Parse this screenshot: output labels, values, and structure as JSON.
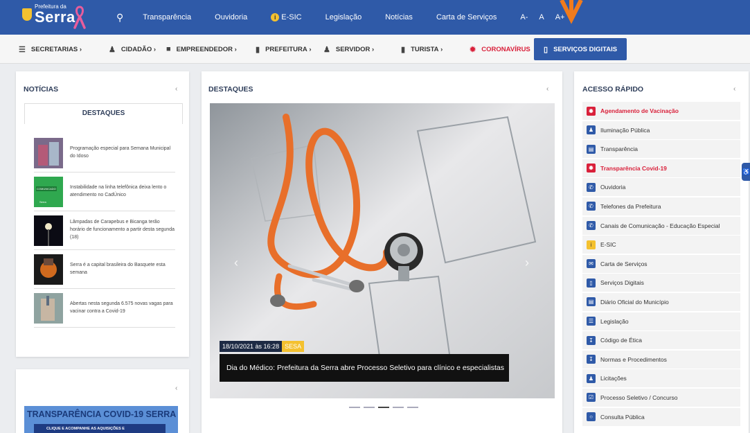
{
  "colors": {
    "primary": "#2f5aa8",
    "accent_red": "#d9203a",
    "accent_yellow": "#f4c12f"
  },
  "header": {
    "logo_small": "Prefeitura da",
    "logo_big": "Serra",
    "nav": [
      {
        "label": "Transparência",
        "icon": ""
      },
      {
        "label": "Ouvidoria",
        "icon": ""
      },
      {
        "label": "E-SIC",
        "icon": "info-icon"
      },
      {
        "label": "Legislação",
        "icon": ""
      },
      {
        "label": "Notícias",
        "icon": ""
      },
      {
        "label": "Carta de Serviços",
        "icon": ""
      }
    ],
    "font_controls": [
      "A-",
      "A",
      "A+"
    ]
  },
  "menu": {
    "items": [
      {
        "label": "SECRETARIAS",
        "icon": "list-icon"
      },
      {
        "label": "CIDADÃO",
        "icon": "users-icon"
      },
      {
        "label": "EMPREENDEDOR",
        "icon": "building-icon"
      },
      {
        "label": "PREFEITURA",
        "icon": "office-icon"
      },
      {
        "label": "SERVIDOR",
        "icon": "user-icon"
      },
      {
        "label": "TURISTA",
        "icon": "suitcase-icon"
      },
      {
        "label": "CORONAVÍRUS",
        "icon": "virus-icon"
      }
    ],
    "digital": "SERVIÇOS DIGITAIS"
  },
  "news": {
    "title": "NOTÍCIAS",
    "tab": "DESTAQUES",
    "items": [
      {
        "text": "Programação especial para Semana Municipal do Idoso"
      },
      {
        "text": "Instabilidade na linha telefônica deixa lento o atendimento no CadÚnico"
      },
      {
        "text": "Lâmpadas de Carapebus e Bicanga terão horário de funcionamento a partir desta segunda (18)"
      },
      {
        "text": "Serra é a capital brasileira do Basquete esta semana"
      },
      {
        "text": "Abertas nesta segunda 6.575 novas vagas para vacinar contra a Covid-19"
      }
    ],
    "thumb_small_labels": [
      "COMUNICADO",
      "Serra"
    ]
  },
  "highlights": {
    "title": "DESTAQUES",
    "date": "18/10/2021 às 16:28",
    "tag": "SESA",
    "caption": "Dia do Médico: Prefeitura da Serra abre Processo Seletivo para clínico e especialistas",
    "slide_count": 5,
    "active_slide": 3
  },
  "quick": {
    "title": "ACESSO RÁPIDO",
    "items": [
      {
        "label": "Agendamento de Vacinação",
        "icon": "virus-icon",
        "style": "red"
      },
      {
        "label": "Iluminação Pública",
        "icon": "users-icon",
        "style": ""
      },
      {
        "label": "Transparência",
        "icon": "document-icon",
        "style": ""
      },
      {
        "label": "Transparência Covid-19",
        "icon": "virus-icon",
        "style": "red"
      },
      {
        "label": "Ouvidoria",
        "icon": "phone-icon",
        "style": ""
      },
      {
        "label": "Telefones da Prefeitura",
        "icon": "phone-icon",
        "style": ""
      },
      {
        "label": "Canais de Comunicação - Educação Especial",
        "icon": "phone-icon",
        "style": ""
      },
      {
        "label": "E-SIC",
        "icon": "info-icon",
        "style": "yellow"
      },
      {
        "label": "Carta de Serviços",
        "icon": "envelope-icon",
        "style": ""
      },
      {
        "label": "Serviços Digitais",
        "icon": "tablet-icon",
        "style": ""
      },
      {
        "label": "Diário Oficial do Município",
        "icon": "newspaper-icon",
        "style": ""
      },
      {
        "label": "Legislação",
        "icon": "list-icon",
        "style": ""
      },
      {
        "label": "Código de Ética",
        "icon": "download-icon",
        "style": ""
      },
      {
        "label": "Normas e Procedimentos",
        "icon": "download-icon",
        "style": ""
      },
      {
        "label": "Licitações",
        "icon": "users-icon",
        "style": ""
      },
      {
        "label": "Processo Seletivo / Concurso",
        "icon": "checkbox-icon",
        "style": ""
      },
      {
        "label": "Consulta Pública",
        "icon": "chat-icon",
        "style": ""
      }
    ]
  },
  "covid": {
    "title": "TRANSPARÊNCIA COVID-19 SERRA",
    "sub": "CLIQUE E ACOMPANHE AS AQUISIÇÕES E"
  }
}
